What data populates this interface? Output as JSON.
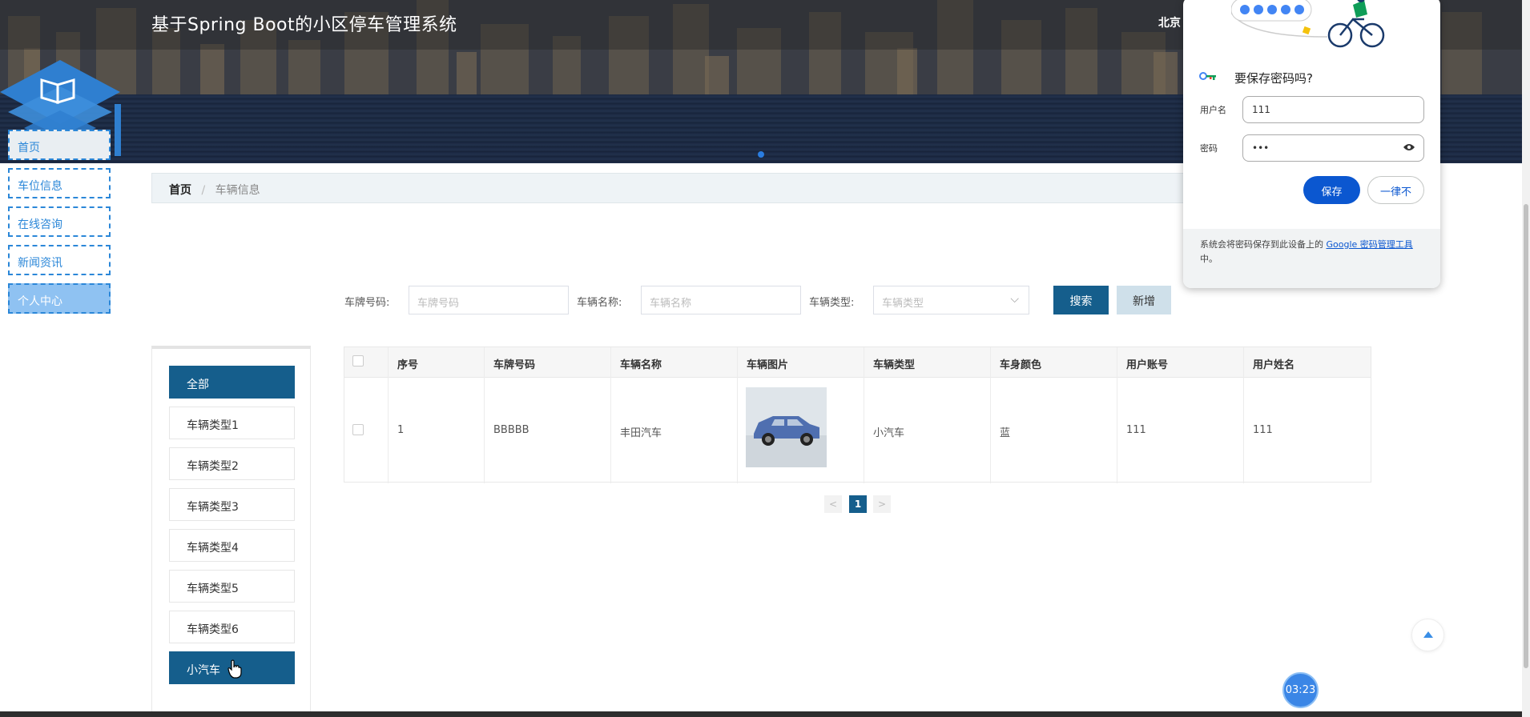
{
  "header": {
    "site_title": "基于Spring Boot的小区停车管理系统",
    "city_text": "北京"
  },
  "nav": {
    "items": [
      {
        "label": "首页"
      },
      {
        "label": "车位信息"
      },
      {
        "label": "在线咨询"
      },
      {
        "label": "新闻资讯"
      },
      {
        "label": "个人中心"
      }
    ]
  },
  "breadcrumb": {
    "home": "首页",
    "current": "车辆信息"
  },
  "search": {
    "plate_label": "车牌号码:",
    "plate_placeholder": "车牌号码",
    "name_label": "车辆名称:",
    "name_placeholder": "车辆名称",
    "type_label": "车辆类型:",
    "type_placeholder": "车辆类型",
    "search_button": "搜索",
    "add_button": "新增"
  },
  "categories": [
    {
      "label": "全部"
    },
    {
      "label": "车辆类型1"
    },
    {
      "label": "车辆类型2"
    },
    {
      "label": "车辆类型3"
    },
    {
      "label": "车辆类型4"
    },
    {
      "label": "车辆类型5"
    },
    {
      "label": "车辆类型6"
    },
    {
      "label": "小汽车"
    }
  ],
  "table": {
    "headers": [
      "序号",
      "车牌号码",
      "车辆名称",
      "车辆图片",
      "车辆类型",
      "车身颜色",
      "用户账号",
      "用户姓名"
    ],
    "rows": [
      {
        "index": "1",
        "plate": "BBBBB",
        "name": "丰田汽车",
        "type": "小汽车",
        "color": "蓝",
        "account": "111",
        "username": "111"
      }
    ]
  },
  "pagination": {
    "prev": "<",
    "current": "1",
    "next": ">"
  },
  "password_popup": {
    "title": "要保存密码吗?",
    "username_label": "用户名",
    "username_value": "111",
    "password_label": "密码",
    "password_value": "•••",
    "save_button": "保存",
    "never_button": "一律不",
    "footer_prefix": "系统会将密码保存到此设备上的 ",
    "footer_link": "Google 密码管理工具",
    "footer_suffix": "中。"
  },
  "timer": "03:23",
  "colors": {
    "primary": "#155e8c",
    "nav_border": "#2b87d8",
    "nav_active": "#8fc2f2",
    "google_blue": "#0b57d0"
  }
}
